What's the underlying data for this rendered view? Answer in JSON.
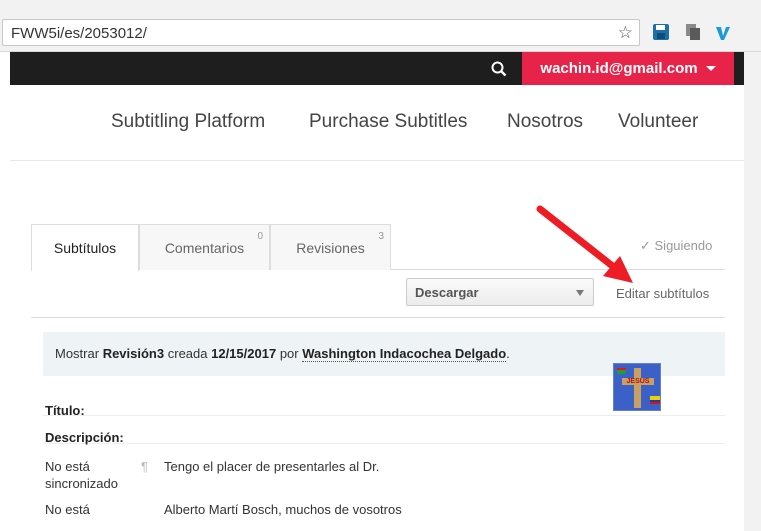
{
  "browser": {
    "url": "FWW5i/es/2053012/",
    "star_icon": "star-icon",
    "extensions": [
      "save-icon",
      "copy-icon",
      "vimeo-icon"
    ]
  },
  "topnav": {
    "account_email": "wachin.id@gmail.com"
  },
  "mainnav": {
    "items": [
      "Subtitling Platform",
      "Purchase Subtitles",
      "Nosotros",
      "Volunteer"
    ]
  },
  "tabs": [
    {
      "label": "Subtítulos",
      "count": ""
    },
    {
      "label": "Comentarios",
      "count": "0"
    },
    {
      "label": "Revisiones",
      "count": "3"
    }
  ],
  "following": "✓ Siguiendo",
  "toolbar": {
    "download_label": "Descargar",
    "edit_label": "Editar subtítulos"
  },
  "revision": {
    "prefix": "Mostrar",
    "revision": "Revisión3",
    "created": "creada",
    "date": "12/15/2017",
    "by": "por",
    "author": "Washington Indacochea Delgado",
    "suffix": "."
  },
  "meta": {
    "title_label": "Título:",
    "description_label": "Descripción:"
  },
  "subtitles": [
    {
      "status": "No está sincronizado",
      "pilcrow": "¶",
      "text": "Tengo el placer de presentarles al Dr."
    },
    {
      "status": "No está",
      "pilcrow": "",
      "text": "Alberto Martí Bosch, muchos de vosotros"
    }
  ],
  "colors": {
    "accent": "#e8234a",
    "nav_dark": "#1e1e1e",
    "arrow": "#ee1c24"
  }
}
